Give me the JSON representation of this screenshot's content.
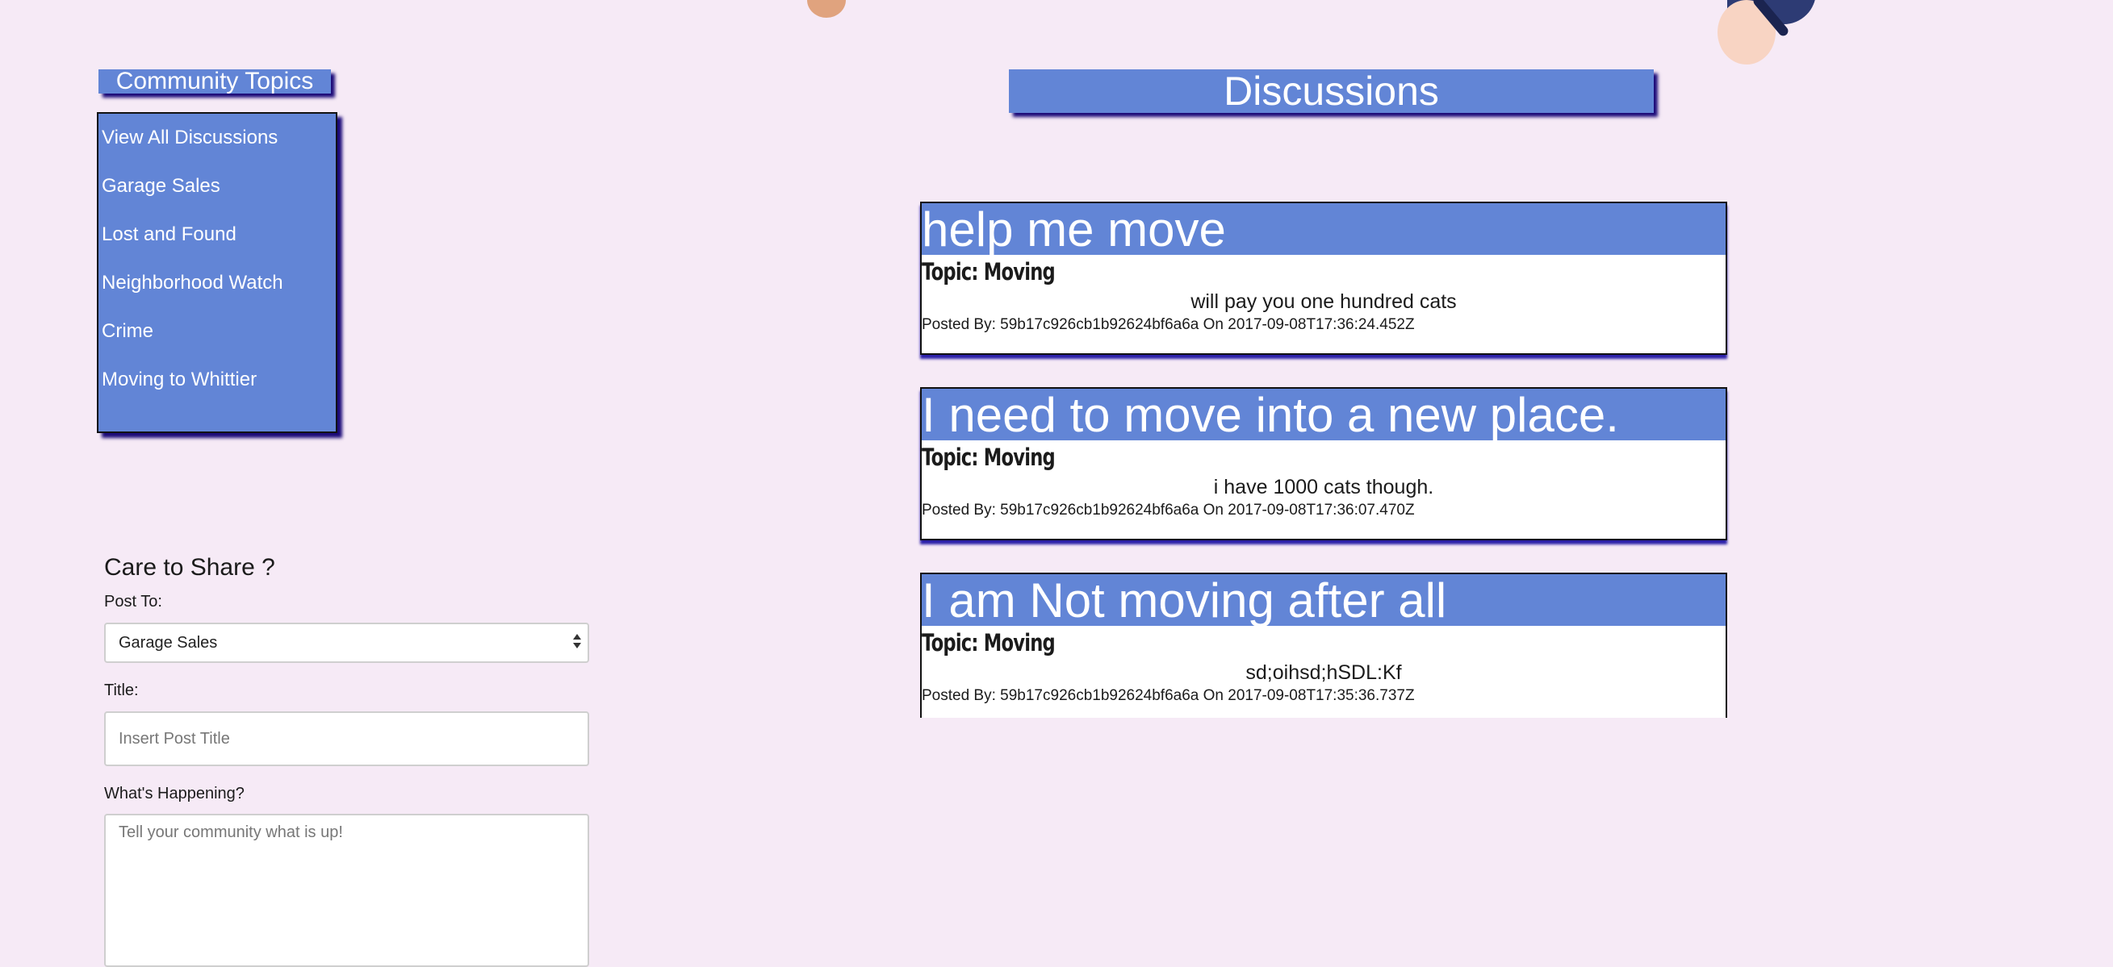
{
  "sidebar": {
    "heading": "Community Topics",
    "topics": [
      {
        "label": "View All Discussions"
      },
      {
        "label": "Garage Sales"
      },
      {
        "label": "Lost and Found"
      },
      {
        "label": "Neighborhood Watch"
      },
      {
        "label": "Crime"
      },
      {
        "label": "Moving to Whittier"
      }
    ]
  },
  "share_form": {
    "title": "Care to Share ?",
    "post_to_label": "Post To:",
    "post_to_selected": "Garage Sales",
    "title_label": "Title:",
    "title_placeholder": "Insert Post Title",
    "happening_label": "What's Happening?",
    "happening_placeholder": "Tell your community what is up!"
  },
  "discussions": {
    "heading": "Discussions",
    "posts": [
      {
        "title": "help me move",
        "topic": "Topic: Moving",
        "body": "will pay you one hundred cats",
        "meta": "Posted By: 59b17c926cb1b92624bf6a6a On 2017-09-08T17:36:24.452Z"
      },
      {
        "title": "I need to move into a new place.",
        "topic": "Topic: Moving",
        "body": "i have 1000 cats though.",
        "meta": "Posted By: 59b17c926cb1b92624bf6a6a On 2017-09-08T17:36:07.470Z"
      },
      {
        "title": "I am Not moving after all",
        "topic": "Topic: Moving",
        "body": "sd;oihsd;hSDL:Kf",
        "meta": "Posted By: 59b17c926cb1b92624bf6a6a On 2017-09-08T17:35:36.737Z"
      }
    ]
  },
  "colors": {
    "background": "#f6eaf6",
    "accent": "#6285d6",
    "shadow": "#1b0a78"
  }
}
